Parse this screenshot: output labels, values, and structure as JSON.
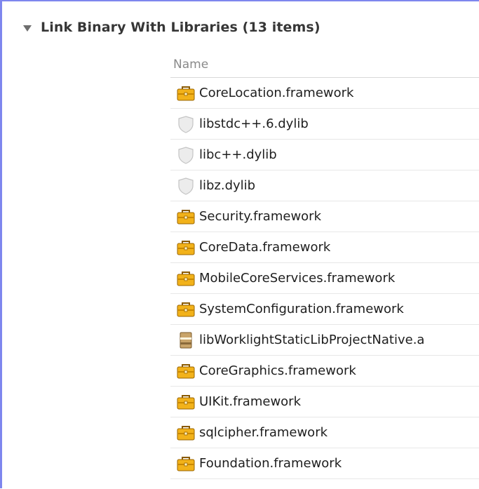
{
  "section": {
    "title": "Link Binary With Libraries (13 items)",
    "disclosure_icon": "disclosure-triangle-down-icon"
  },
  "table": {
    "column_header": "Name",
    "rows": [
      {
        "label": "CoreLocation.framework",
        "icon": "framework-toolbox-icon"
      },
      {
        "label": "libstdc++.6.dylib",
        "icon": "dylib-shield-icon"
      },
      {
        "label": "libc++.dylib",
        "icon": "dylib-shield-icon"
      },
      {
        "label": "libz.dylib",
        "icon": "dylib-shield-icon"
      },
      {
        "label": "Security.framework",
        "icon": "framework-toolbox-icon"
      },
      {
        "label": "CoreData.framework",
        "icon": "framework-toolbox-icon"
      },
      {
        "label": "MobileCoreServices.framework",
        "icon": "framework-toolbox-icon"
      },
      {
        "label": "SystemConfiguration.framework",
        "icon": "framework-toolbox-icon"
      },
      {
        "label": "libWorklightStaticLibProjectNative.a",
        "icon": "static-library-icon"
      },
      {
        "label": "CoreGraphics.framework",
        "icon": "framework-toolbox-icon"
      },
      {
        "label": "UIKit.framework",
        "icon": "framework-toolbox-icon"
      },
      {
        "label": "sqlcipher.framework",
        "icon": "framework-toolbox-icon"
      },
      {
        "label": "Foundation.framework",
        "icon": "framework-toolbox-icon"
      }
    ]
  },
  "colors": {
    "frame_border": "#7e86ee",
    "framework_icon": "#e8a300",
    "dylib_icon": "#d9d9d9"
  }
}
